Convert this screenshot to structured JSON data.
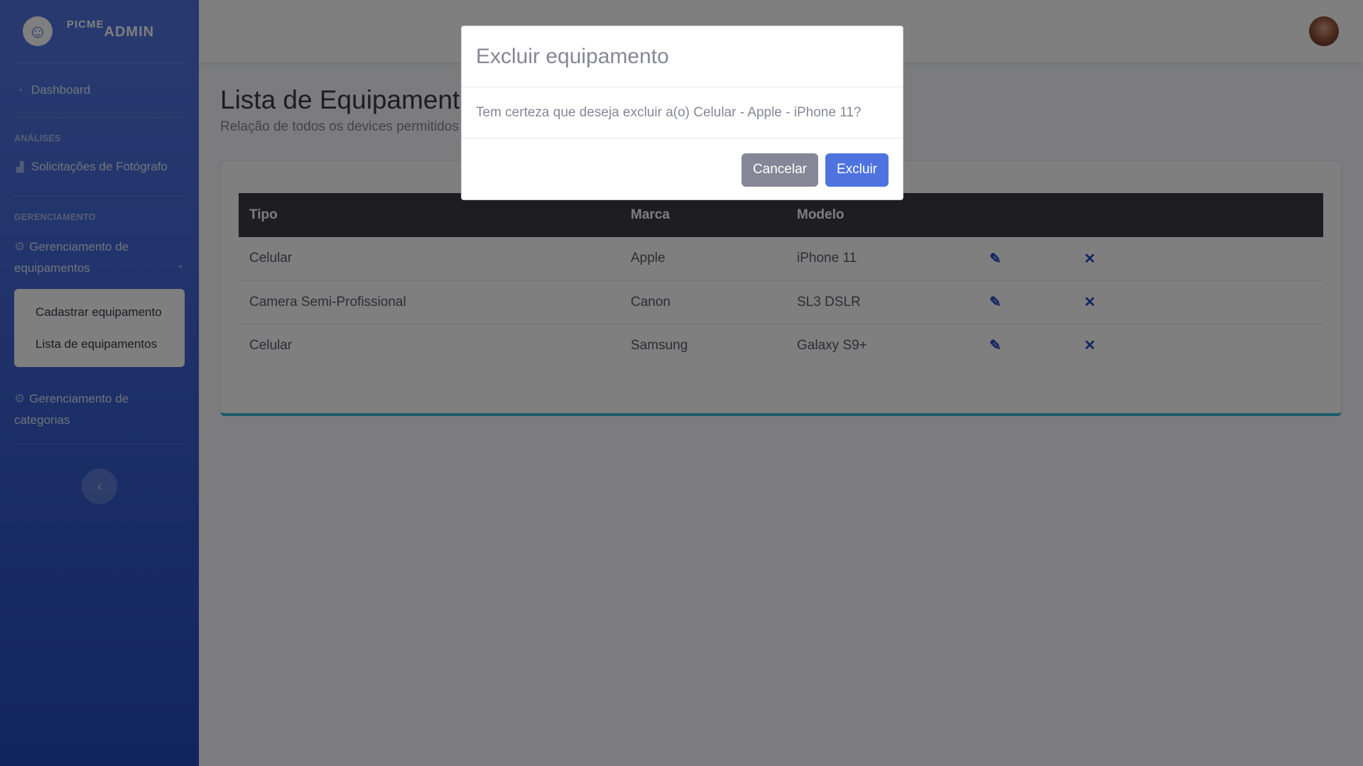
{
  "brand": {
    "picme": "PICME",
    "admin": "ADMIN"
  },
  "sidebar": {
    "dashboard": "Dashboard",
    "heading_analises": "ANÁLISES",
    "solicitacoes": "Solicitações de Fotógrafo",
    "heading_gerenciamento": "GERENCIAMENTO",
    "equipamentos_line1": "Gerenciamento de",
    "equipamentos_line2": "equipamentos",
    "sub_items": [
      "Cadastrar equipamento",
      "Lista de equipamentos"
    ],
    "categorias_line1": "Gerenciamento de",
    "categorias_line2": "categorias"
  },
  "page": {
    "title": "Lista de Equipamentos",
    "subtitle": "Relação de todos os devices permitidos para que o fotógrafo registre como seu equipamento de trabalho."
  },
  "table": {
    "headers": [
      "Tipo",
      "Marca",
      "Modelo"
    ],
    "rows": [
      {
        "tipo": "Celular",
        "marca": "Apple",
        "modelo": "iPhone 11"
      },
      {
        "tipo": "Camera Semi-Profissional",
        "marca": "Canon",
        "modelo": "SL3 DSLR"
      },
      {
        "tipo": "Celular",
        "marca": "Samsung",
        "modelo": "Galaxy S9+"
      }
    ]
  },
  "modal": {
    "title": "Excluir equipamento",
    "body": "Tem certeza que deseja excluir a(o) Celular - Apple - iPhone 11?",
    "cancel": "Cancelar",
    "confirm": "Excluir"
  },
  "icons": {
    "edit": "edit-icon",
    "delete": "times-icon",
    "toggle": "chevron-left-icon"
  },
  "colors": {
    "primary": "#4e73df",
    "sidebar_end": "#224abe",
    "secondary": "#858796",
    "table_header": "#3a3b45"
  }
}
